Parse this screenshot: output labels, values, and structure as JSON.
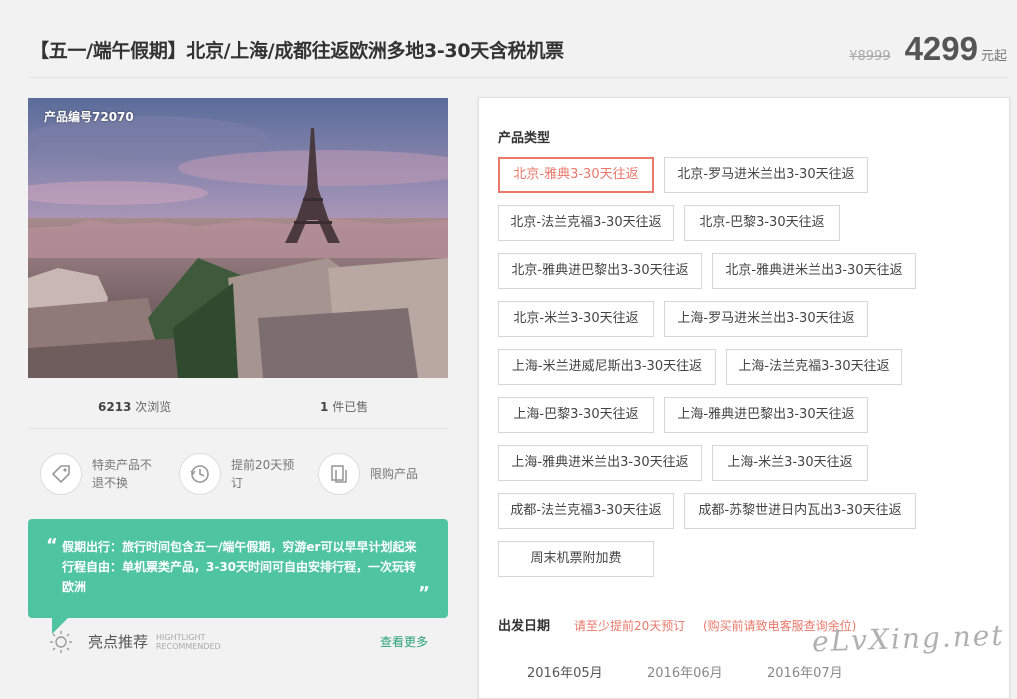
{
  "header": {
    "title": "【五一/端午假期】北京/上海/成都往返欧洲多地3-30天含税机票",
    "old_price": "¥8999",
    "price": "4299",
    "price_suffix": "元起"
  },
  "photo": {
    "product_id": "产品编号72070"
  },
  "stats": {
    "views_count": "6213",
    "views_label": "次浏览",
    "sold_count": "1",
    "sold_label": "件已售"
  },
  "features": [
    {
      "text": "特卖产品不退不换",
      "icon": "tag-icon"
    },
    {
      "text": "提前20天预订",
      "icon": "history-clock-icon"
    },
    {
      "text": "限购产品",
      "icon": "copy-pages-icon"
    }
  ],
  "quote": {
    "open_mark": "“",
    "close_mark": "”",
    "text": "假期出行：旅行时间包含五一/端午假期，穷游er可以早早计划起来 行程自由：单机票类产品，3-30天时间可自由安排行程，一次玩转欧洲"
  },
  "highlights": {
    "title": "亮点推荐",
    "sub1": "HIGHTLIGHT",
    "sub2": "RECOMMENDED",
    "more": "查看更多"
  },
  "product_type": {
    "label": "产品类型",
    "options": [
      "北京-雅典3-30天往返",
      "北京-罗马进米兰出3-30天往返",
      "北京-法兰克福3-30天往返",
      "北京-巴黎3-30天往返",
      "北京-雅典进巴黎出3-30天往返",
      "北京-雅典进米兰出3-30天往返",
      "北京-米兰3-30天往返",
      "上海-罗马进米兰出3-30天往返",
      "上海-米兰进威尼斯出3-30天往返",
      "上海-法兰克福3-30天往返",
      "上海-巴黎3-30天往返",
      "上海-雅典进巴黎出3-30天往返",
      "上海-雅典进米兰出3-30天往返",
      "上海-米兰3-30天往返",
      "成都-法兰克福3-30天往返",
      "成都-苏黎世进日内瓦出3-30天往返",
      "周末机票附加费"
    ],
    "selected": "北京-雅典3-30天往返"
  },
  "departure": {
    "label": "出发日期",
    "note1": "请至少提前20天预订",
    "note2": "(购买前请致电客服查询余位)",
    "months": [
      "2016年05月",
      "2016年06月",
      "2016年07月"
    ]
  },
  "watermark": "eLvXing.net",
  "colors": {
    "accent": "#e9786b",
    "teal": "#4fc4a0",
    "link": "#2aa27a"
  }
}
